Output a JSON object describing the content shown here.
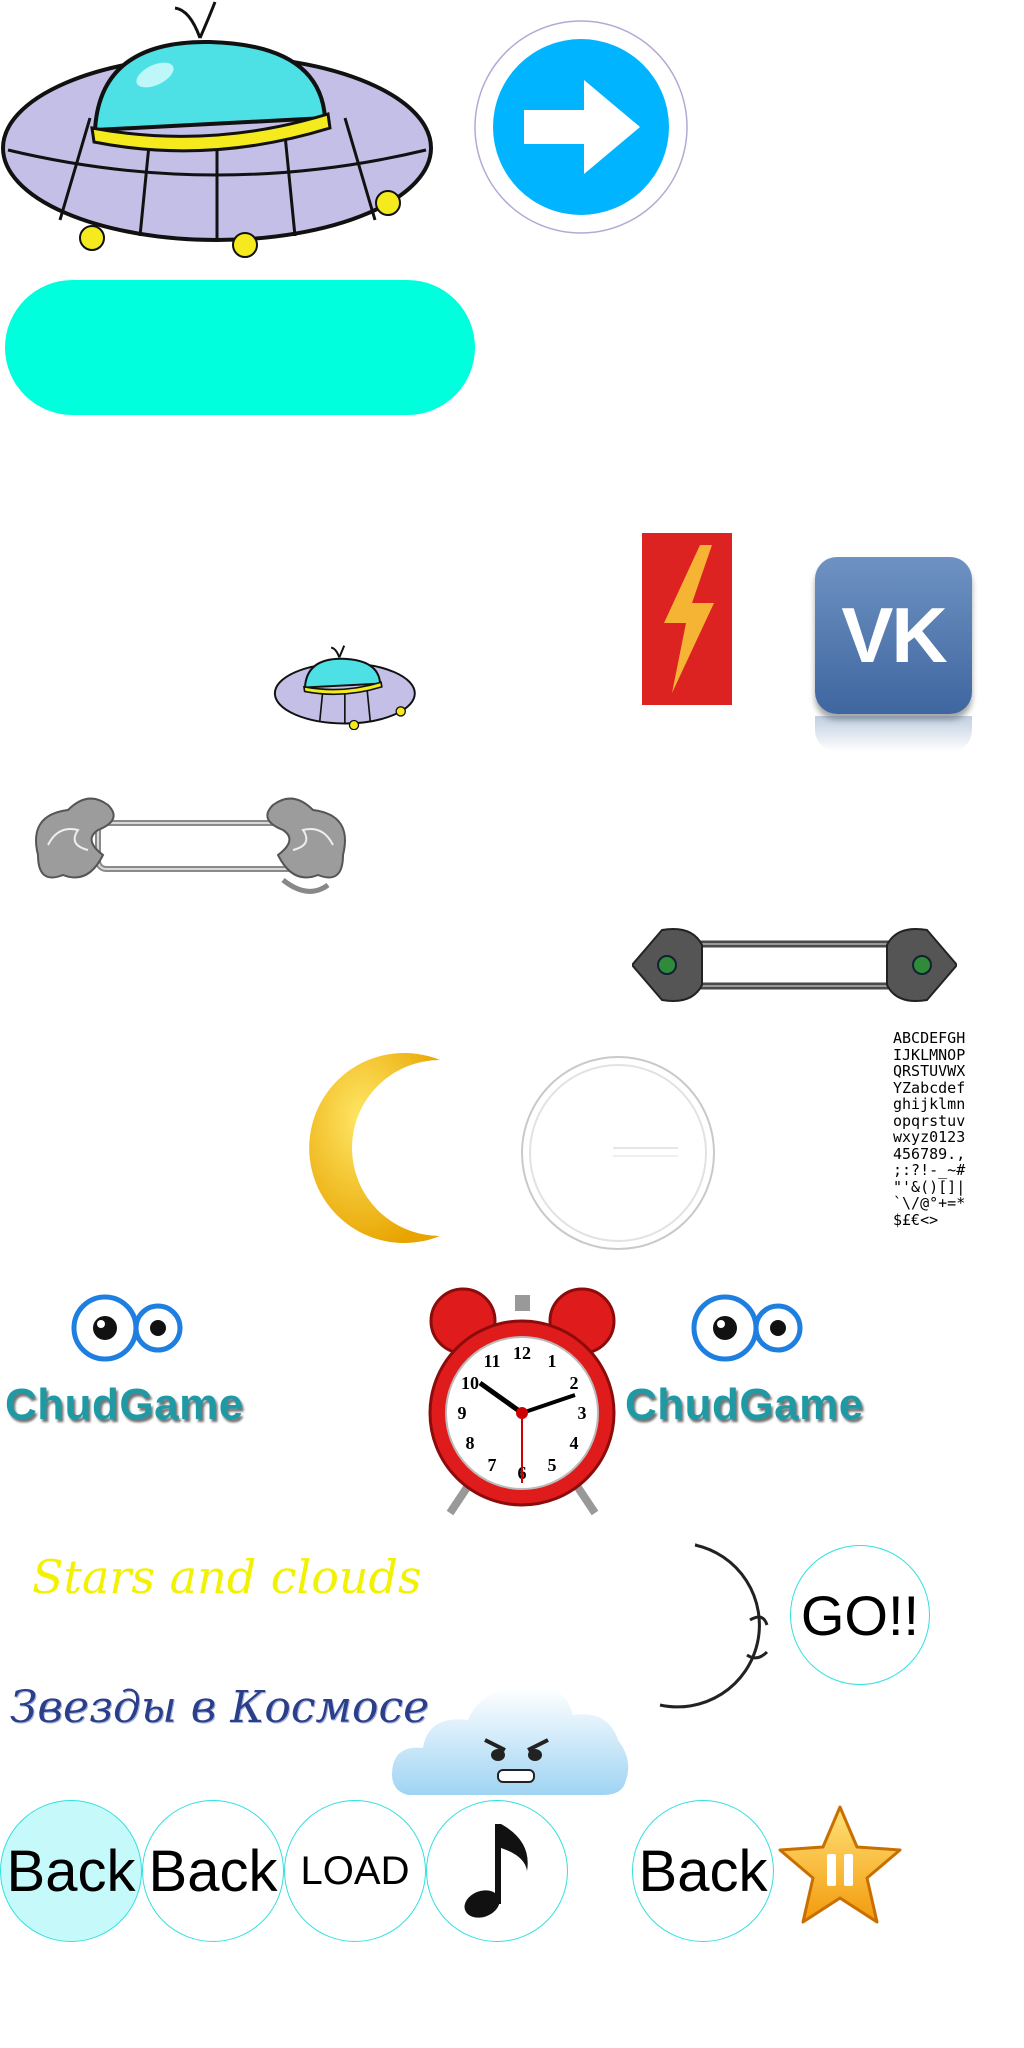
{
  "sprites": {
    "chud_game_text": "ChudGame",
    "stars_and_clouds": "Stars and clouds",
    "zvezdy_v_kosmose": "Звезды в Космосе",
    "vk_text": "VK",
    "font_sheet": [
      "ABCDEFGH",
      "IJKLMNOP",
      "QRSTUVWX",
      "YZabcdef",
      "ghijklmn",
      "opqrstuv",
      "wxyz0123",
      "456789.,",
      ";:?!-_~#",
      "\"'&()[]|",
      "`\\/@°+=*",
      "$£€<>"
    ],
    "clock_numbers": [
      "12",
      "1",
      "2",
      "3",
      "4",
      "5",
      "6",
      "7",
      "8",
      "9",
      "10",
      "11"
    ]
  },
  "buttons": {
    "go": "GO!!",
    "back_1": "Back",
    "back_2": "Back",
    "load": "LOAD",
    "back_3": "Back"
  },
  "colors": {
    "cyan_bar": "#00ffdd",
    "arrow_blue": "#00b4ff",
    "button_outline": "#33e0e0",
    "moon_yellow": "#ffcc00",
    "chud_teal": "#1f9aa4",
    "title_yellow": "#f2f200",
    "title_navy": "#2a3e8a",
    "vk_blue": "#4b74a6",
    "lightning_red": "#dd2222",
    "clock_red": "#e01b1b"
  }
}
